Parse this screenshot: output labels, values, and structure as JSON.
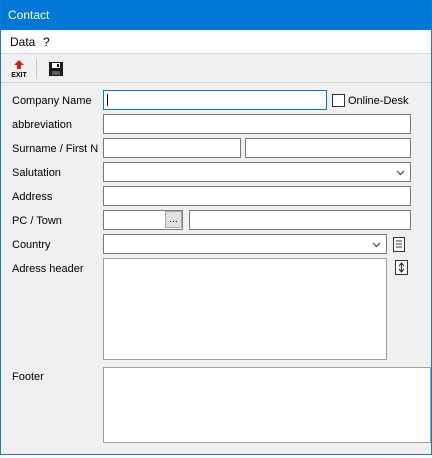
{
  "window": {
    "title": "Contact"
  },
  "menu": {
    "data": "Data",
    "help": "?"
  },
  "toolbar": {
    "exit_label": "EXIT"
  },
  "form": {
    "company_name_label": "Company Name",
    "company_name_value": "",
    "online_desk_label": "Online-Desk",
    "online_desk_checked": false,
    "abbreviation_label": "abbreviation",
    "abbreviation_value": "",
    "surname_first_label": "Surname / First N",
    "surname_value": "",
    "first_name_value": "",
    "salutation_label": "Salutation",
    "salutation_value": "",
    "address_label": "Address",
    "address_value": "",
    "pc_town_label": "PC / Town",
    "postcode_value": "",
    "postcode_button_label": "...",
    "town_value": "",
    "country_label": "Country",
    "country_value": "",
    "address_header_label": "Adress header",
    "address_header_value": "",
    "footer_label": "Footer",
    "footer_value": ""
  },
  "colors": {
    "titlebar": "#0078d7",
    "focus_border": "#0078d7",
    "exit_arrow": "#d42020"
  }
}
